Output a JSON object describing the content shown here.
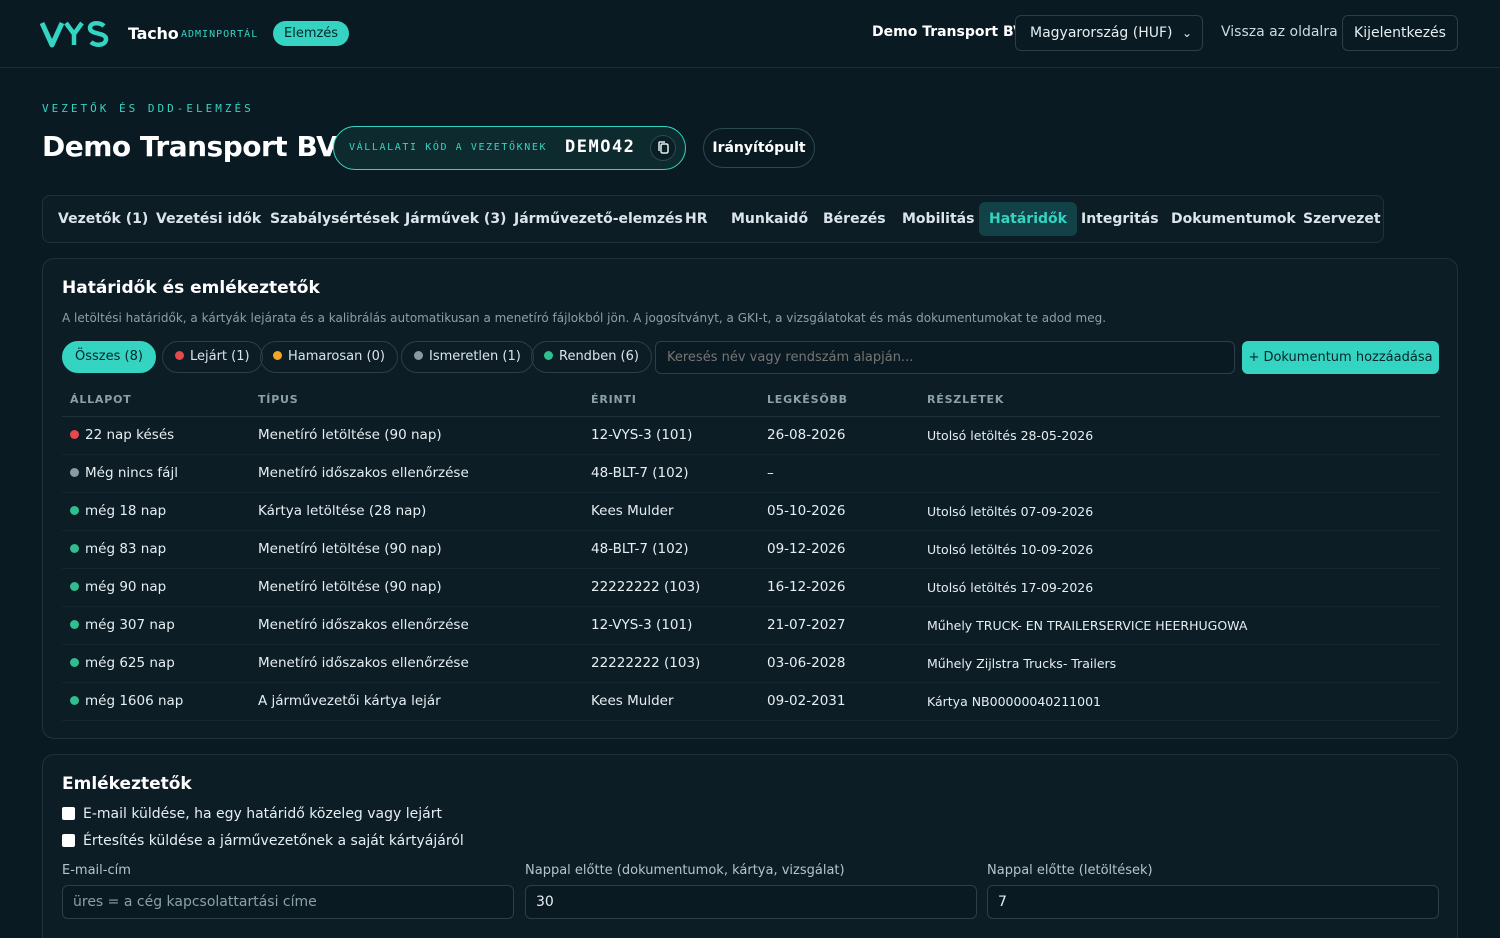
{
  "header": {
    "brand_name": "Tacho",
    "brand_sub": "ADMINPORTÁL",
    "mode_pill": "Elemzés",
    "company": "Demo Transport BV",
    "country_select": "Magyarország (HUF)",
    "back_link": "Vissza az oldalra",
    "logout": "Kijelentkezés"
  },
  "page": {
    "kicker": "VEZETŐK ÉS DDD-ELEMZÉS",
    "title": "Demo Transport BV",
    "code_label": "VÁLLALATI KÓD A VEZETŐKNEK",
    "code_value": "DEMO42",
    "dashboard_button": "Irányítópult"
  },
  "tabs": [
    {
      "label": "Vezetők (1)"
    },
    {
      "label": "Vezetési idők"
    },
    {
      "label": "Szabálysértések"
    },
    {
      "label": "Járművek (3)"
    },
    {
      "label": "Járművezető-elemzés"
    },
    {
      "label": "HR"
    },
    {
      "label": "Munkaidő"
    },
    {
      "label": "Bérezés"
    },
    {
      "label": "Mobilitás"
    },
    {
      "label": "Határidők"
    },
    {
      "label": "Integritás"
    },
    {
      "label": "Dokumentumok"
    },
    {
      "label": "Szervezet"
    }
  ],
  "deadlines": {
    "title": "Határidők és emlékeztetők",
    "description": "A letöltési határidők, a kártyák lejárata és a kalibrálás automatikusan a menetíró fájlokból jön. A jogosítványt, a GKI-t, a vizsgálatokat és más dokumentumokat te adod meg.",
    "filters": [
      {
        "label": "Összes (8)",
        "color": ""
      },
      {
        "label": "Lejárt (1)",
        "color": "#e5484d"
      },
      {
        "label": "Hamarosan (0)",
        "color": "#f5a524"
      },
      {
        "label": "Ismeretlen (1)",
        "color": "#8a9aa3"
      },
      {
        "label": "Rendben (6)",
        "color": "#2fbf8f"
      }
    ],
    "search_placeholder": "Keresés név vagy rendszám alapján...",
    "add_button": "+ Dokumentum hozzáadása",
    "columns": [
      "ÁLLAPOT",
      "TÍPUS",
      "ÉRINTI",
      "LEGKÉSŐBB",
      "RÉSZLETEK"
    ],
    "rows": [
      {
        "status": "22 nap késés",
        "status_color": "#e5484d",
        "type": "Menetíró letöltése (90 nap)",
        "subject": "12-VYS-3 (101)",
        "due": "26-08-2026",
        "details": "Utolsó letöltés 28-05-2026"
      },
      {
        "status": "Még nincs fájl",
        "status_color": "#8a9aa3",
        "type": "Menetíró időszakos ellenőrzése",
        "subject": "48-BLT-7 (102)",
        "due": "–",
        "details": ""
      },
      {
        "status": "még 18 nap",
        "status_color": "#2fbf8f",
        "type": "Kártya letöltése (28 nap)",
        "subject": "Kees Mulder",
        "due": "05-10-2026",
        "details": "Utolsó letöltés 07-09-2026"
      },
      {
        "status": "még 83 nap",
        "status_color": "#2fbf8f",
        "type": "Menetíró letöltése (90 nap)",
        "subject": "48-BLT-7 (102)",
        "due": "09-12-2026",
        "details": "Utolsó letöltés 10-09-2026"
      },
      {
        "status": "még 90 nap",
        "status_color": "#2fbf8f",
        "type": "Menetíró letöltése (90 nap)",
        "subject": "22222222 (103)",
        "due": "16-12-2026",
        "details": "Utolsó letöltés 17-09-2026"
      },
      {
        "status": "még 307 nap",
        "status_color": "#2fbf8f",
        "type": "Menetíró időszakos ellenőrzése",
        "subject": "12-VYS-3 (101)",
        "due": "21-07-2027",
        "details": "Műhely TRUCK- EN TRAILERSERVICE HEERHUGOWA"
      },
      {
        "status": "még 625 nap",
        "status_color": "#2fbf8f",
        "type": "Menetíró időszakos ellenőrzése",
        "subject": "22222222 (103)",
        "due": "03-06-2028",
        "details": "Műhely Zijlstra Trucks- Trailers"
      },
      {
        "status": "még 1606 nap",
        "status_color": "#2fbf8f",
        "type": "A járművezetői kártya lejár",
        "subject": "Kees Mulder",
        "due": "09-02-2031",
        "details": "Kártya NB00000040211001"
      }
    ]
  },
  "reminders": {
    "title": "Emlékeztetők",
    "checkbox_email": "E-mail küldése, ha egy határidő közeleg vagy lejárt",
    "checkbox_driver": "Értesítés küldése a járművezetőnek a saját kártyájáról",
    "email_label": "E-mail-cím",
    "email_placeholder": "üres = a cég kapcsolattartási címe",
    "days_docs_label": "Nappal előtte (dokumentumok, kártya, vizsgálat)",
    "days_docs_value": "30",
    "days_downloads_label": "Nappal előtte (letöltések)",
    "days_downloads_value": "7"
  },
  "icons": {
    "logo": "vys-logo",
    "copy": "copy-icon",
    "chevron": "chevron-down-icon"
  },
  "colors": {
    "accent": "#35d4c2",
    "background": "#0a1a22",
    "overdue": "#e5484d",
    "ok": "#2fbf8f",
    "unknown": "#8a9aa3",
    "soon": "#f5a524"
  }
}
